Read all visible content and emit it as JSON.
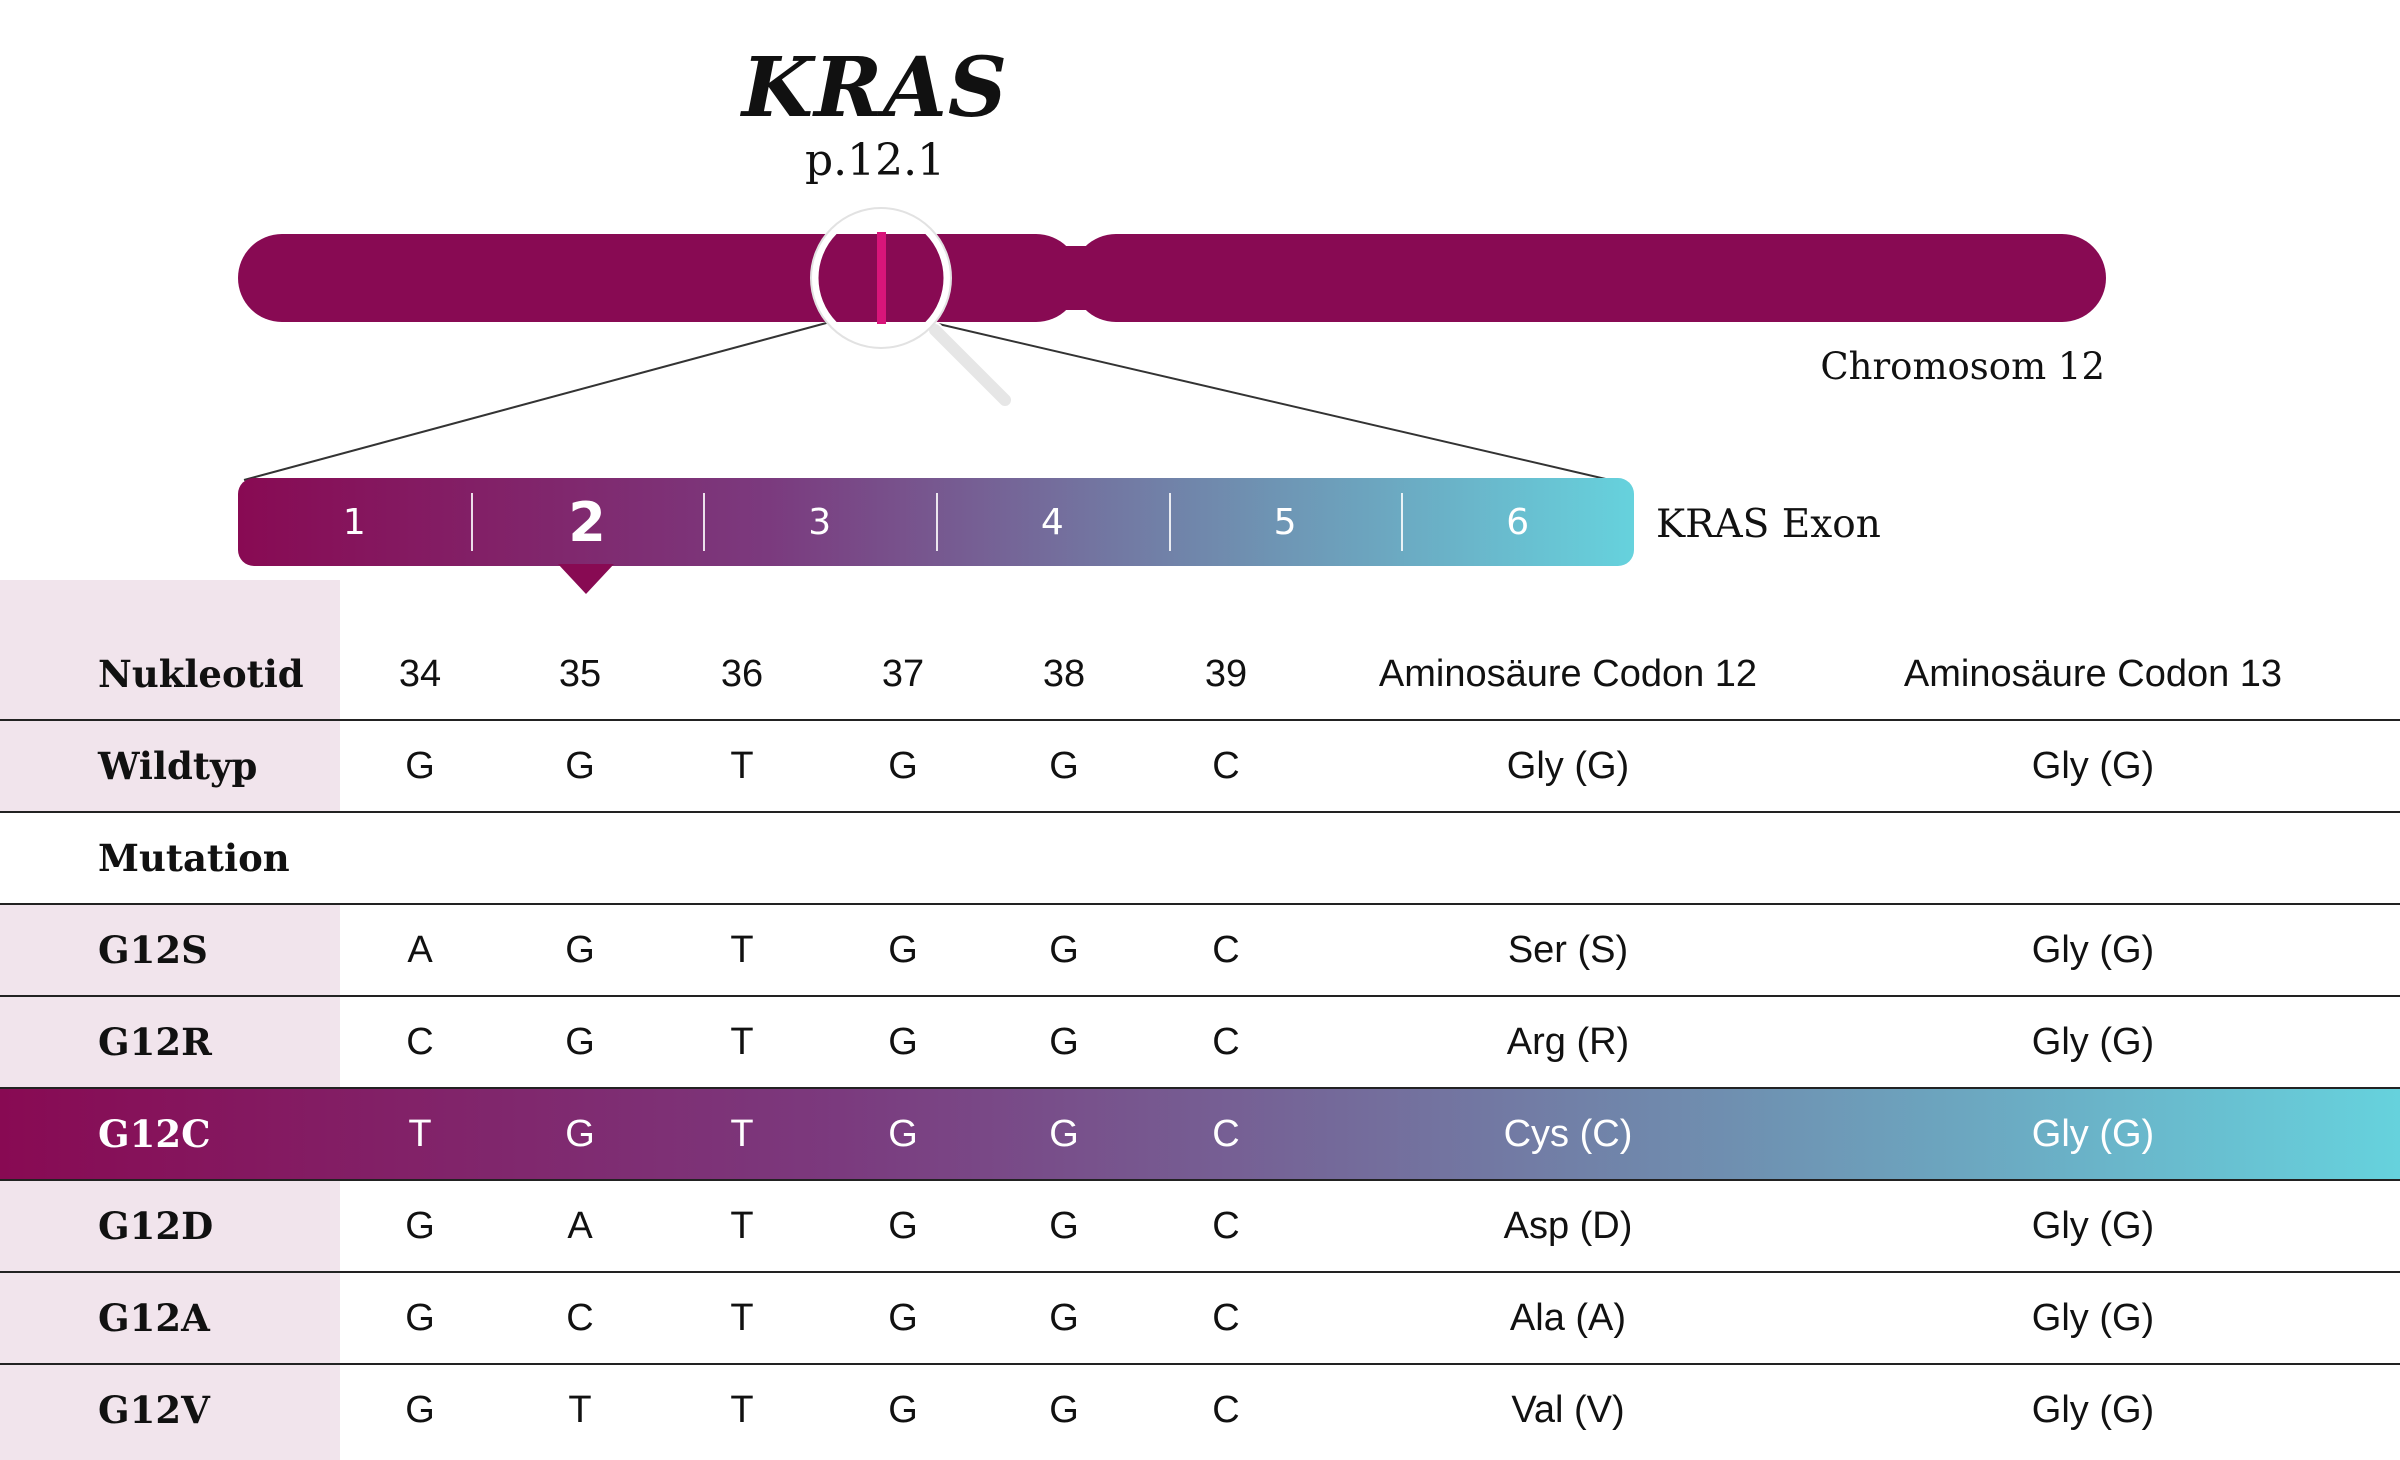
{
  "title": {
    "gene": "KRAS",
    "band": "p.12.1"
  },
  "chromosome": {
    "label": "Chromosom 12",
    "color": "#880a53",
    "highlight_color": "#d8157a"
  },
  "exons": {
    "label": "KRAS Exon",
    "items": [
      "1",
      "2",
      "3",
      "4",
      "5",
      "6"
    ],
    "active": "2",
    "gradient": [
      "#880a53",
      "#66d2dd"
    ]
  },
  "table": {
    "header": {
      "label": "Nukleotid",
      "cols": [
        "34",
        "35",
        "36",
        "37",
        "38",
        "39",
        "Aminosäure Codon 12",
        "Aminosäure Codon 13"
      ]
    },
    "wildtype": {
      "label": "Wildtyp",
      "cols": [
        "G",
        "G",
        "T",
        "G",
        "G",
        "C",
        "Gly (G)",
        "Gly (G)"
      ]
    },
    "mutation_label": "Mutation",
    "rows": [
      {
        "label": "G12S",
        "cols": [
          "A",
          "G",
          "T",
          "G",
          "G",
          "C",
          "Ser (S)",
          "Gly (G)"
        ],
        "highlight": false
      },
      {
        "label": "G12R",
        "cols": [
          "C",
          "G",
          "T",
          "G",
          "G",
          "C",
          "Arg (R)",
          "Gly (G)"
        ],
        "highlight": false
      },
      {
        "label": "G12C",
        "cols": [
          "T",
          "G",
          "T",
          "G",
          "G",
          "C",
          "Cys (C)",
          "Gly (G)"
        ],
        "highlight": true
      },
      {
        "label": "G12D",
        "cols": [
          "G",
          "A",
          "T",
          "G",
          "G",
          "C",
          "Asp (D)",
          "Gly (G)"
        ],
        "highlight": false
      },
      {
        "label": "G12A",
        "cols": [
          "G",
          "C",
          "T",
          "G",
          "G",
          "C",
          "Ala (A)",
          "Gly (G)"
        ],
        "highlight": false
      },
      {
        "label": "G12V",
        "cols": [
          "G",
          "T",
          "T",
          "G",
          "G",
          "C",
          "Val (V)",
          "Gly (G)"
        ],
        "highlight": false
      }
    ]
  }
}
